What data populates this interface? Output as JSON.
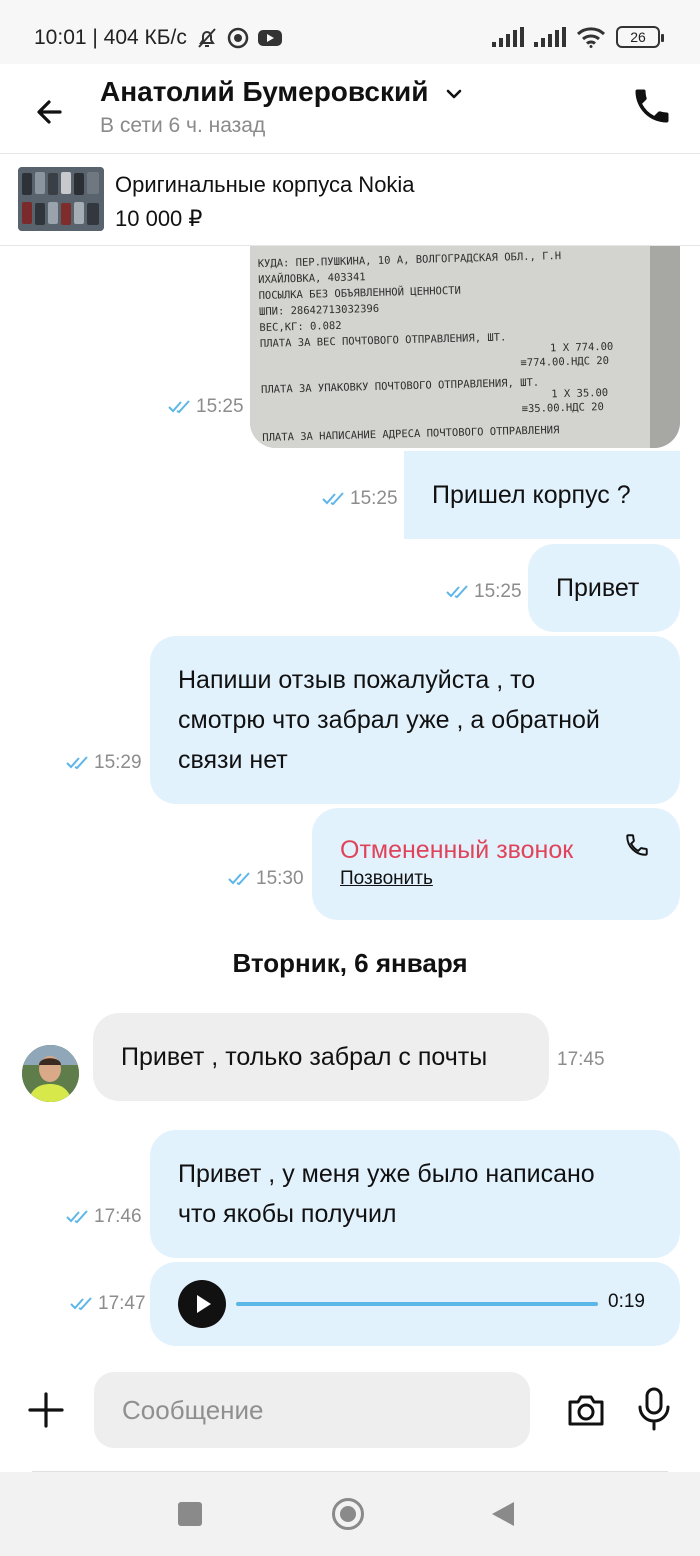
{
  "status_bar": {
    "time_speed": "10:01 | 404 КБ/с",
    "battery": "26",
    "icons": [
      "bell-off-icon",
      "target-icon",
      "youtube-icon",
      "signal-icon",
      "signal-icon",
      "wifi-icon",
      "battery-icon"
    ]
  },
  "header": {
    "name": "Анатолий Бумеровский",
    "status": "В сети 6 ч. назад",
    "icons": [
      "back-arrow-icon",
      "chevron-down-icon",
      "phone-icon"
    ]
  },
  "listing": {
    "title": "Оригинальные корпуса Nokia",
    "price": "10 000 ₽"
  },
  "messages": [
    {
      "type": "photo",
      "direction": "out",
      "time": "15:25"
    },
    {
      "type": "text",
      "direction": "out",
      "text": "Пришел корпус ?",
      "time": "15:25"
    },
    {
      "type": "text",
      "direction": "out",
      "text": "Привет",
      "time": "15:25"
    },
    {
      "type": "text",
      "direction": "out",
      "lines": [
        "Напиши отзыв пожалуйста , то",
        "смотрю что забрал  уже , а обратной",
        "связи нет"
      ],
      "time": "15:29"
    },
    {
      "type": "call",
      "direction": "out",
      "title": "Отмененный звонок",
      "action": "Позвонить",
      "time": "15:30"
    },
    {
      "type": "date",
      "text": "Вторник, 6 января"
    },
    {
      "type": "text",
      "direction": "in",
      "text": "Привет , только забрал с почты",
      "time": "17:45"
    },
    {
      "type": "text",
      "direction": "out",
      "lines": [
        "Привет , у меня уже было написано",
        "что якобы получил"
      ],
      "time": "17:46"
    },
    {
      "type": "voice",
      "direction": "out",
      "duration": "0:19",
      "time": "17:47"
    }
  ],
  "receipt_lines": [
    "КУДА: ПЕР.ПУШКИНА, 10 А, ВОЛГОГРАДСКАЯ ОБЛ., Г.Н",
    "ИХАЙЛОВКА, 403341",
    "ПОСЫЛКА БЕЗ ОБЪЯВЛЕННОЙ ЦЕННОСТИ",
    "ШПИ: 28642713032396",
    "ВЕС,КГ: 0.082",
    "ПЛАТА ЗА ВЕС ПОЧТОВОГО ОТПРАВЛЕНИЯ, ШТ.",
    "1 Х 774.00",
    "≡774.00.НДС 20",
    "ПЛАТА ЗА УПАКОВКУ ПОЧТОВОГО ОТПРАВЛЕНИЯ, ШТ.",
    "1 Х 35.00",
    "≡35.00.НДС 20",
    "ПЛАТА ЗА НАПИСАНИЕ АДРЕСА ПОЧТОВОГО ОТПРАВЛЕНИЯ"
  ],
  "composer": {
    "placeholder": "Сообщение",
    "icons": [
      "plus-icon",
      "camera-icon",
      "mic-icon"
    ]
  },
  "colors": {
    "outgoing_bubble": "#e2f2fd",
    "incoming_bubble": "#eeeeee",
    "missed_call": "#e0445a",
    "read_ticks": "#5db6e8",
    "voice_track": "#5db6e8"
  }
}
